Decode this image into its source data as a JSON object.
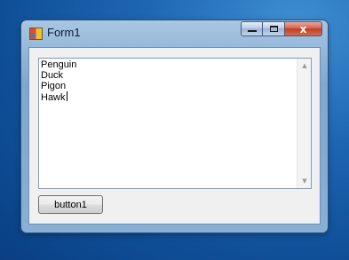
{
  "window": {
    "title": "Form1",
    "controls": {
      "minimize": "",
      "maximize": "",
      "close": "x"
    }
  },
  "textbox": {
    "lines": [
      "Penguin",
      "Duck",
      "Pigon",
      "Hawk"
    ]
  },
  "button": {
    "label": "button1"
  },
  "colors": {
    "desktop": "#1f67b3",
    "titlebar": "#88afd4",
    "close": "#c13f25",
    "form_bg": "#f0f0f0"
  }
}
